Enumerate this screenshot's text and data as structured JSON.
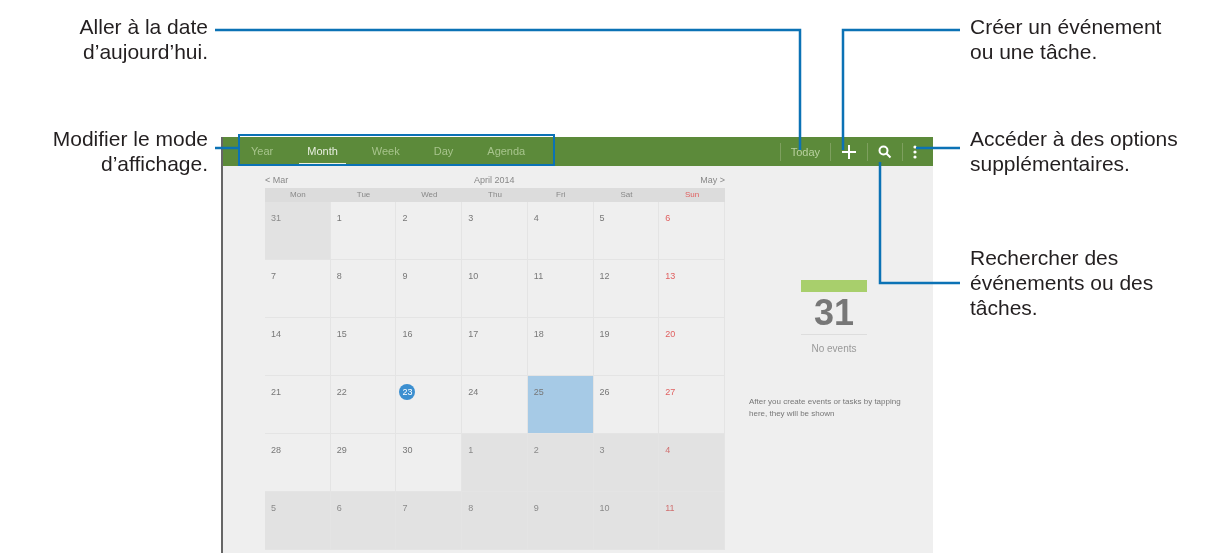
{
  "left_callouts": [
    "Aller à la date\nd’aujourd’hui.",
    "Modifier le mode\nd’affichage."
  ],
  "right_callouts": [
    "Créer un événement\nou une tâche.",
    "Accéder à des options\nsupplémentaires.",
    "Rechercher des\névénements ou des\ntâches."
  ],
  "tabs": [
    {
      "label": "Year",
      "selected": false
    },
    {
      "label": "Month",
      "selected": true
    },
    {
      "label": "Week",
      "selected": false
    },
    {
      "label": "Day",
      "selected": false
    },
    {
      "label": "Agenda",
      "selected": false
    }
  ],
  "today_button": "Today",
  "nav": {
    "prev": "< Mar",
    "title": "April 2014",
    "next": "May >"
  },
  "weekdays": [
    "Mon",
    "Tue",
    "Wed",
    "Thu",
    "Fri",
    "Sat",
    "Sun"
  ],
  "weeks": [
    [
      {
        "label": "31",
        "other_month": true,
        "today": false,
        "selected": false
      },
      {
        "label": "1",
        "other_month": false,
        "today": false,
        "selected": false
      },
      {
        "label": "2",
        "other_month": false,
        "today": false,
        "selected": false
      },
      {
        "label": "3",
        "other_month": false,
        "today": false,
        "selected": false
      },
      {
        "label": "4",
        "other_month": false,
        "today": false,
        "selected": false
      },
      {
        "label": "5",
        "other_month": false,
        "today": false,
        "selected": false
      },
      {
        "label": "6",
        "other_month": false,
        "today": false,
        "selected": false
      }
    ],
    [
      {
        "label": "7",
        "other_month": false,
        "today": false,
        "selected": false
      },
      {
        "label": "8",
        "other_month": false,
        "today": false,
        "selected": false
      },
      {
        "label": "9",
        "other_month": false,
        "today": false,
        "selected": false
      },
      {
        "label": "10",
        "other_month": false,
        "today": false,
        "selected": false
      },
      {
        "label": "11",
        "other_month": false,
        "today": false,
        "selected": false
      },
      {
        "label": "12",
        "other_month": false,
        "today": false,
        "selected": false
      },
      {
        "label": "13",
        "other_month": false,
        "today": false,
        "selected": false
      }
    ],
    [
      {
        "label": "14",
        "other_month": false,
        "today": false,
        "selected": false
      },
      {
        "label": "15",
        "other_month": false,
        "today": false,
        "selected": false
      },
      {
        "label": "16",
        "other_month": false,
        "today": false,
        "selected": false
      },
      {
        "label": "17",
        "other_month": false,
        "today": false,
        "selected": false
      },
      {
        "label": "18",
        "other_month": false,
        "today": false,
        "selected": false
      },
      {
        "label": "19",
        "other_month": false,
        "today": false,
        "selected": false
      },
      {
        "label": "20",
        "other_month": false,
        "today": false,
        "selected": false
      }
    ],
    [
      {
        "label": "21",
        "other_month": false,
        "today": false,
        "selected": false
      },
      {
        "label": "22",
        "other_month": false,
        "today": false,
        "selected": false
      },
      {
        "label": "23",
        "other_month": false,
        "today": true,
        "selected": false
      },
      {
        "label": "24",
        "other_month": false,
        "today": false,
        "selected": false
      },
      {
        "label": "25",
        "other_month": false,
        "today": false,
        "selected": true
      },
      {
        "label": "26",
        "other_month": false,
        "today": false,
        "selected": false
      },
      {
        "label": "27",
        "other_month": false,
        "today": false,
        "selected": false
      }
    ],
    [
      {
        "label": "28",
        "other_month": false,
        "today": false,
        "selected": false
      },
      {
        "label": "29",
        "other_month": false,
        "today": false,
        "selected": false
      },
      {
        "label": "30",
        "other_month": false,
        "today": false,
        "selected": false
      },
      {
        "label": "1",
        "other_month": true,
        "today": false,
        "selected": false
      },
      {
        "label": "2",
        "other_month": true,
        "today": false,
        "selected": false
      },
      {
        "label": "3",
        "other_month": true,
        "today": false,
        "selected": false
      },
      {
        "label": "4",
        "other_month": true,
        "today": false,
        "selected": false
      }
    ],
    [
      {
        "label": "5",
        "other_month": true,
        "today": false,
        "selected": false
      },
      {
        "label": "6",
        "other_month": true,
        "today": false,
        "selected": false
      },
      {
        "label": "7",
        "other_month": true,
        "today": false,
        "selected": false
      },
      {
        "label": "8",
        "other_month": true,
        "today": false,
        "selected": false
      },
      {
        "label": "9",
        "other_month": true,
        "today": false,
        "selected": false
      },
      {
        "label": "10",
        "other_month": true,
        "today": false,
        "selected": false
      },
      {
        "label": "11",
        "other_month": true,
        "today": false,
        "selected": false
      }
    ]
  ],
  "side_panel": {
    "date": "31",
    "status": "No events",
    "hint": "After you create events or tasks by tapping here, they will be shown"
  }
}
